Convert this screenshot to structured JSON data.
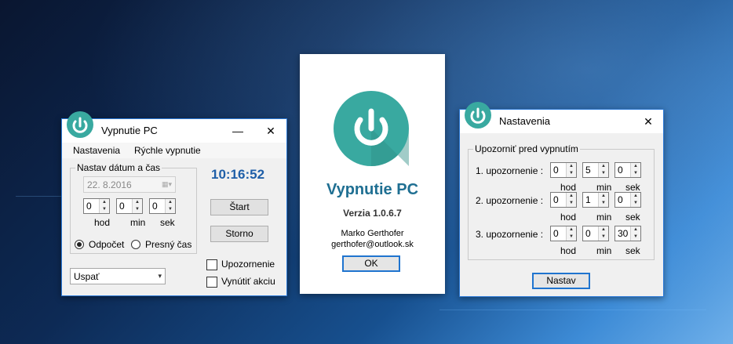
{
  "main_window": {
    "title": "Vypnutie PC",
    "menu": [
      "Nastavenia",
      "Rýchle vypnutie"
    ],
    "group_title": "Nastav dátum a čas",
    "date_value": "22.  8.2016",
    "spinners": [
      {
        "value": "0",
        "label": "hod"
      },
      {
        "value": "0",
        "label": "min"
      },
      {
        "value": "0",
        "label": "sek"
      }
    ],
    "radio_countdown": "Odpočet",
    "radio_exact": "Presný čas",
    "clock": "10:16:52",
    "start_button": "Štart",
    "cancel_button": "Storno",
    "check_warning": "Upozornenie",
    "check_force": "Vynútiť akciu",
    "action_select": "Uspať",
    "close_glyph": "✕",
    "minimize_glyph": "—",
    "accent_color": "#1f74cf"
  },
  "about_window": {
    "app_name": "Vypnutie PC",
    "version": "Verzia 1.0.6.7",
    "author": "Marko Gerthofer",
    "email": "gerthofer@outlook.sk",
    "ok_button": "OK",
    "icon_color": "#39a9a0"
  },
  "settings_window": {
    "title": "Nastavenia",
    "group_title": "Upozorniť pred vypnutím",
    "close_glyph": "✕",
    "rows": [
      {
        "label": "1. upozornenie :",
        "hod": "0",
        "min": "5",
        "sek": "0"
      },
      {
        "label": "2. upozornenie :",
        "hod": "0",
        "min": "1",
        "sek": "0"
      },
      {
        "label": "3. upozornenie :",
        "hod": "0",
        "min": "0",
        "sek": "30"
      }
    ],
    "unit_labels": {
      "hod": "hod",
      "min": "min",
      "sek": "sek"
    },
    "set_button": "Nastav"
  }
}
